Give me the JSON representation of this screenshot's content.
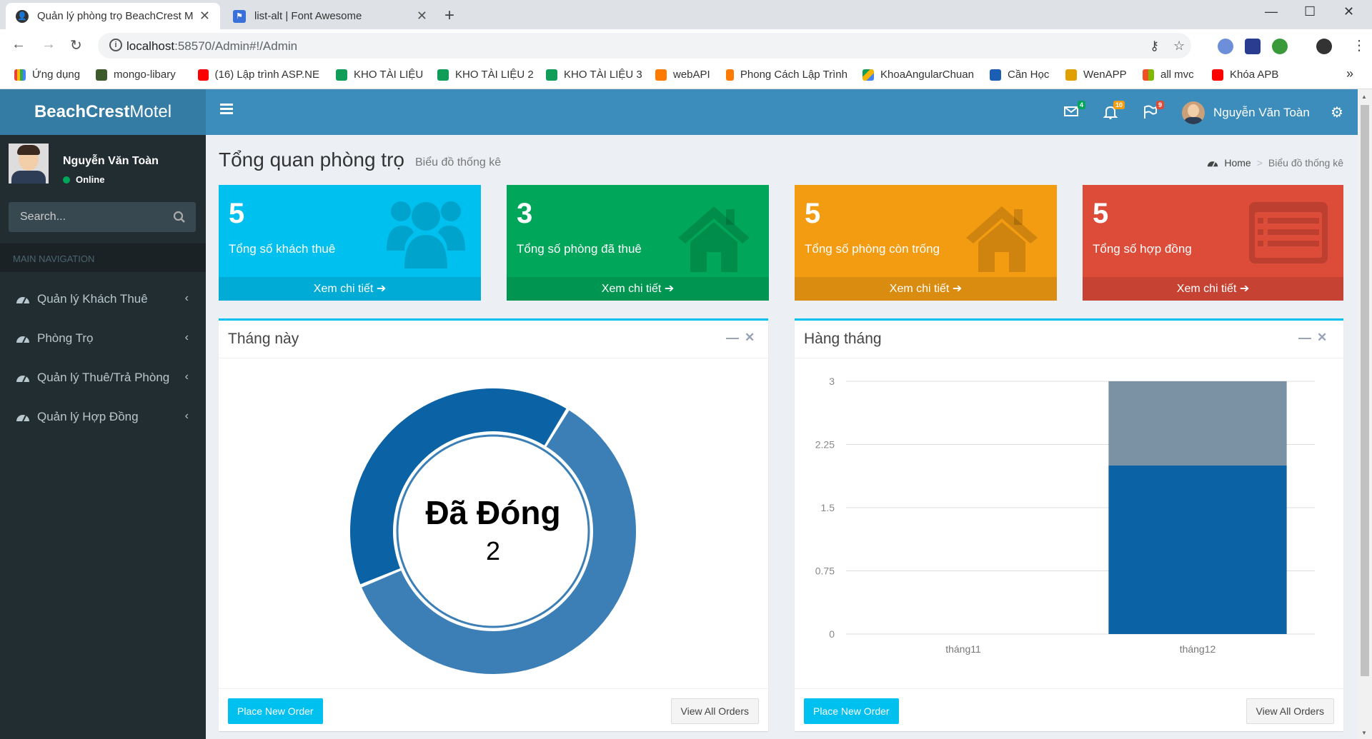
{
  "browser": {
    "tabs": [
      {
        "title": "Quản lý phòng trọ BeachCrest M"
      },
      {
        "title": "list-alt | Font Awesome"
      }
    ],
    "url_host": "localhost",
    "url_path": ":58570/Admin#!/Admin",
    "bookmarks": [
      {
        "label": "Ứng dụng",
        "color": "#ea4335"
      },
      {
        "label": "mongo-libary",
        "color": "#3d5a2a"
      },
      {
        "label": "(16) Lập trình ASP.NE",
        "color": "#ff0000"
      },
      {
        "label": "KHO TÀI LIỆU",
        "color": "#0f9d58"
      },
      {
        "label": "KHO TÀI LIỆU 2",
        "color": "#0f9d58"
      },
      {
        "label": "KHO TÀI LIỆU 3",
        "color": "#0f9d58"
      },
      {
        "label": "webAPI",
        "color": "#ff7a00"
      },
      {
        "label": "Phong Cách Lập Trình",
        "color": "#ff7a00"
      },
      {
        "label": "KhoaAngularChuan",
        "color": "#4285f4"
      },
      {
        "label": "Cần Học",
        "color": "#1a5fb4"
      },
      {
        "label": "WenAPP",
        "color": "#e0a000"
      },
      {
        "label": "all mvc",
        "color": "#7fba00"
      },
      {
        "label": "Khóa APB",
        "color": "#ff0000"
      }
    ]
  },
  "header": {
    "logo_bold": "BeachCrest",
    "logo_light": "Motel",
    "messages_count": "4",
    "notifications_count": "10",
    "tasks_count": "9",
    "user_name": "Nguyễn Văn Toàn"
  },
  "sidebar": {
    "user_name": "Nguyễn Văn Toàn",
    "status": "Online",
    "search_placeholder": "Search...",
    "nav_header": "MAIN NAVIGATION",
    "items": [
      {
        "label": "Quản lý Khách Thuê"
      },
      {
        "label": "Phòng Trọ"
      },
      {
        "label": "Quản lý Thuê/Trả Phòng"
      },
      {
        "label": "Quản lý Hợp Đồng"
      }
    ]
  },
  "page": {
    "title": "Tổng quan phòng trọ",
    "subtitle": "Biểu đồ thống kê",
    "breadcrumb_home": "Home",
    "breadcrumb_current": "Biểu đồ thống kê"
  },
  "stats": [
    {
      "value": "5",
      "label": "Tổng số khách thuê",
      "link": "Xem chi tiết",
      "color": "#00c0ef",
      "icon": "users-icon"
    },
    {
      "value": "3",
      "label": "Tổng số phòng đã thuê",
      "link": "Xem chi tiết",
      "color": "#00a65a",
      "icon": "home-icon"
    },
    {
      "value": "5",
      "label": "Tổng số phòng còn trống",
      "link": "Xem chi tiết",
      "color": "#f39c12",
      "icon": "home-icon"
    },
    {
      "value": "5",
      "label": "Tổng số hợp đồng",
      "link": "Xem chi tiết",
      "color": "#dd4b39",
      "icon": "list-alt-icon"
    }
  ],
  "panels": {
    "left_title": "Tháng này",
    "right_title": "Hàng tháng",
    "place_order": "Place New Order",
    "view_all": "View All Orders"
  },
  "chart_data": [
    {
      "type": "pie",
      "variant": "donut",
      "center_label": "Đã Đóng",
      "center_value": "2",
      "slices": [
        {
          "value": 3,
          "color": "#3c7fb6"
        },
        {
          "value": 2,
          "color": "#0b62a4"
        }
      ]
    },
    {
      "type": "bar",
      "stacked": true,
      "categories": [
        "tháng11",
        "tháng12"
      ],
      "series": [
        {
          "values": [
            0,
            2
          ],
          "color": "#0b62a4"
        },
        {
          "values": [
            0,
            1
          ],
          "color": "#7a92a3"
        }
      ],
      "ylim": [
        0,
        3
      ],
      "yticks": [
        "0",
        "0.75",
        "1.5",
        "2.25",
        "3"
      ],
      "grid": true
    }
  ]
}
